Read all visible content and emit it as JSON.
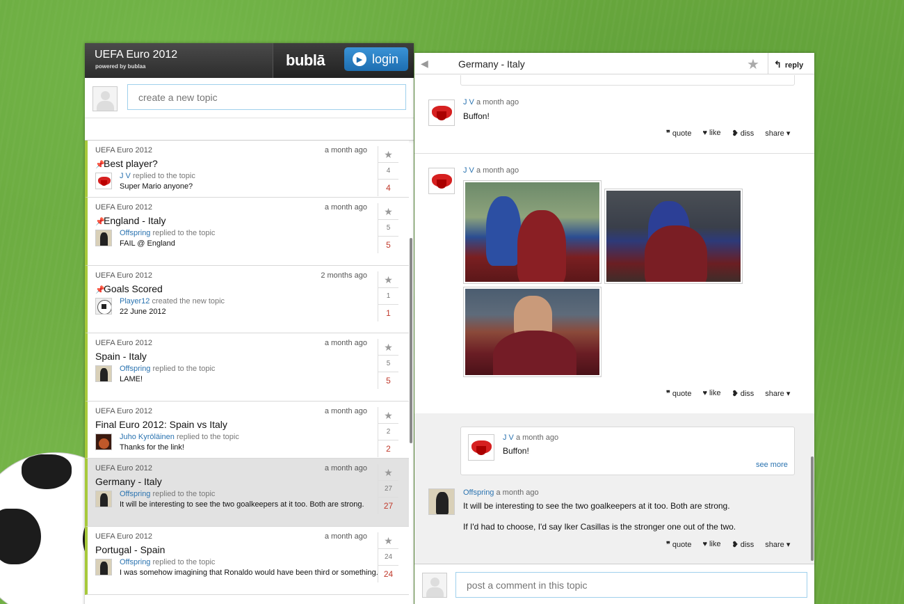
{
  "app": {
    "title": "UEFA Euro 2012",
    "powered_by": "powered by bublaa",
    "brand": "bublā",
    "login_label": "login"
  },
  "new_topic": {
    "placeholder": "create a new topic"
  },
  "topics": [
    {
      "category": "UEFA Euro 2012",
      "time": "a month ago",
      "name": "Best player?",
      "pinned": true,
      "user": "J V",
      "action": "replied to the topic",
      "message": "Super Mario anyone?",
      "count1": "4",
      "count2": "4"
    },
    {
      "category": "UEFA Euro 2012",
      "time": "a month ago",
      "name": "England - Italy",
      "pinned": true,
      "user": "Offspring",
      "action": "replied to the topic",
      "message": "FAIL @ England",
      "count1": "5",
      "count2": "5"
    },
    {
      "category": "UEFA Euro 2012",
      "time": "2 months ago",
      "name": "Goals Scored",
      "pinned": true,
      "user": "Player12",
      "action": "created the new topic",
      "message": "22 June 2012",
      "count1": "1",
      "count2": "1"
    },
    {
      "category": "UEFA Euro 2012",
      "time": "a month ago",
      "name": "Spain - Italy",
      "pinned": false,
      "user": "Offspring",
      "action": "replied to the topic",
      "message": "LAME!",
      "count1": "5",
      "count2": "5"
    },
    {
      "category": "UEFA Euro 2012",
      "time": "a month ago",
      "name": "Final Euro 2012: Spain vs Italy",
      "pinned": false,
      "user": "Juho Kyröläinen",
      "action": "replied to the topic",
      "message": "Thanks for the link!",
      "count1": "2",
      "count2": "2"
    },
    {
      "category": "UEFA Euro 2012",
      "time": "a month ago",
      "name": "Germany - Italy",
      "pinned": false,
      "user": "Offspring",
      "action": "replied to the topic",
      "message": "It will be interesting to see the two goalkeepers at it too. Both are strong.",
      "count1": "27",
      "count2": "27"
    },
    {
      "category": "UEFA Euro 2012",
      "time": "a month ago",
      "name": "Portugal - Spain",
      "pinned": false,
      "user": "Offspring",
      "action": "replied to the topic",
      "message": "I was somehow imagining that Ronaldo would have been third or something.",
      "count1": "24",
      "count2": "24"
    }
  ],
  "thread": {
    "title": "Germany - Italy",
    "reply_label": "reply",
    "actions": {
      "quote": "quote",
      "like": "like",
      "diss": "diss",
      "share": "share"
    },
    "posts": [
      {
        "user": "J V",
        "time": "a month ago",
        "text": "Buffon!"
      },
      {
        "user": "J V",
        "time": "a month ago",
        "text": ""
      },
      {
        "user": "Offspring",
        "time": "a month ago",
        "text": "It will be interesting to see the two goalkeepers at it too. Both are strong.",
        "text2": "If I'd had to choose, I'd say Iker Casillas is the stronger one out of the two."
      }
    ],
    "quoted": {
      "user": "J V",
      "time": "a month ago",
      "text": "Buffon!",
      "see_more": "see more"
    },
    "comment_placeholder": "post a comment in this topic"
  },
  "colors": {
    "accent": "#2a73b0",
    "count_red": "#c0392b",
    "topic_bar": "#a7c93a",
    "login_blue": "#1d6eb1"
  }
}
